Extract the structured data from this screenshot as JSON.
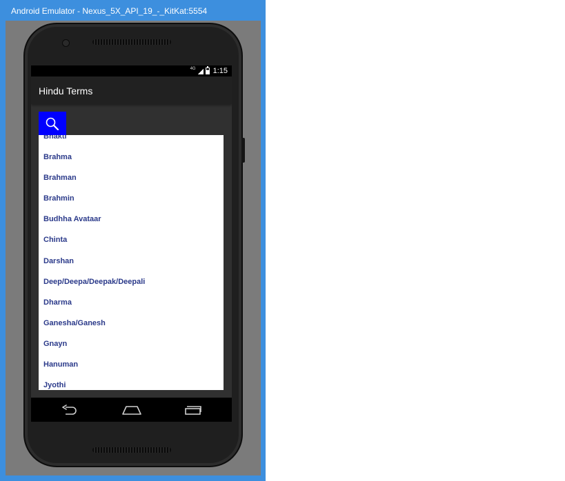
{
  "window": {
    "title": "Android Emulator - Nexus_5X_API_19_-_KitKat:5554"
  },
  "status_bar": {
    "network_label": "4G",
    "time": "1:15"
  },
  "app_bar": {
    "title": "Hindu Terms"
  },
  "search_button": {
    "icon": "search-icon",
    "color": "#0000ff"
  },
  "terms_list": [
    "Bhakti",
    "Brahma",
    "Brahman",
    "Brahmin",
    "Budhha Avataar",
    "Chinta",
    "Darshan",
    "Deep/Deepa/Deepak/Deepali",
    "Dharma",
    "Ganesha/Ganesh",
    "Gnayn",
    "Hanuman",
    "Jyothi"
  ],
  "nav_bar": {
    "back_icon": "back-icon",
    "home_icon": "home-icon",
    "recents_icon": "recents-icon"
  },
  "colors": {
    "window_frame": "#3d8fde",
    "list_text": "#2b3a8a",
    "app_bar": "#212121"
  }
}
